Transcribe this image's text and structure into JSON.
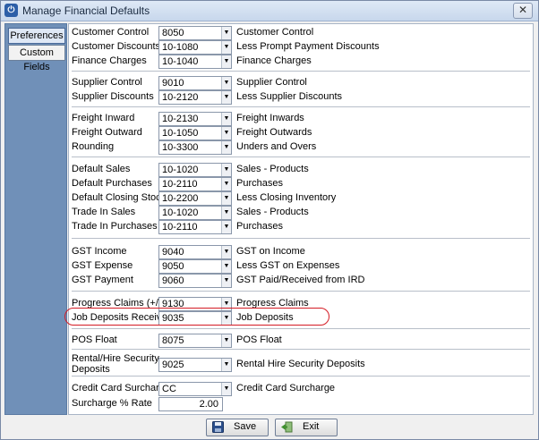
{
  "window": {
    "title": "Manage Financial Defaults",
    "close_glyph": "✕"
  },
  "sidebar": {
    "tabs": [
      {
        "label": "Preferences"
      },
      {
        "label": "Custom Fields"
      }
    ]
  },
  "fields": {
    "customer_control": {
      "label": "Customer Control",
      "value": "8050",
      "description": "Customer Control"
    },
    "customer_discounts": {
      "label": "Customer Discounts",
      "value": "10-1080",
      "description": "Less Prompt Payment Discounts"
    },
    "finance_charges": {
      "label": "Finance Charges",
      "value": "10-1040",
      "description": "Finance Charges"
    },
    "supplier_control": {
      "label": "Supplier Control",
      "value": "9010",
      "description": "Supplier Control"
    },
    "supplier_discounts": {
      "label": "Supplier Discounts",
      "value": "10-2120",
      "description": "Less Supplier Discounts"
    },
    "freight_inward": {
      "label": "Freight Inward",
      "value": "10-2130",
      "description": "Freight Inwards"
    },
    "freight_outward": {
      "label": "Freight Outward",
      "value": "10-1050",
      "description": "Freight Outwards"
    },
    "rounding": {
      "label": "Rounding",
      "value": "10-3300",
      "description": "Unders and Overs"
    },
    "default_sales": {
      "label": "Default Sales",
      "value": "10-1020",
      "description": "Sales - Products"
    },
    "default_purchases": {
      "label": "Default Purchases",
      "value": "10-2110",
      "description": "Purchases"
    },
    "default_closing_stock": {
      "label": "Default Closing Stock",
      "value": "10-2200",
      "description": "Less Closing Inventory"
    },
    "trade_in_sales": {
      "label": "Trade In Sales",
      "value": "10-1020",
      "description": "Sales - Products"
    },
    "trade_in_purchases": {
      "label": "Trade In Purchases",
      "value": "10-2110",
      "description": "Purchases"
    },
    "gst_income": {
      "label": "GST Income",
      "value": "9040",
      "description": "GST on Income"
    },
    "gst_expense": {
      "label": "GST Expense",
      "value": "9050",
      "description": "Less GST on Expenses"
    },
    "gst_payment": {
      "label": "GST Payment",
      "value": "9060",
      "description": "GST Paid/Received from IRD"
    },
    "progress_claims": {
      "label": "Progress Claims (+/-)",
      "value": "9130",
      "description": "Progress Claims"
    },
    "job_deposits_received": {
      "label": "Job Deposits Received",
      "value": "9035",
      "description": "Job Deposits"
    },
    "pos_float": {
      "label": "POS Float",
      "value": "8075",
      "description": "POS Float"
    },
    "rental_hire_security_deposits": {
      "label_line1": "Rental/Hire Security",
      "label_line2": "Deposits",
      "value": "9025",
      "description": "Rental Hire Security Deposits"
    },
    "credit_card_surcharge": {
      "label": "Credit Card Surcharge",
      "value": "CC",
      "description": "Credit Card Surcharge"
    },
    "surcharge_rate": {
      "label": "Surcharge % Rate",
      "value": "2.00"
    }
  },
  "buttons": {
    "save": "Save",
    "exit": "Exit"
  },
  "colors": {
    "highlight": "#d41b24",
    "sidebar": "#7090b8"
  }
}
